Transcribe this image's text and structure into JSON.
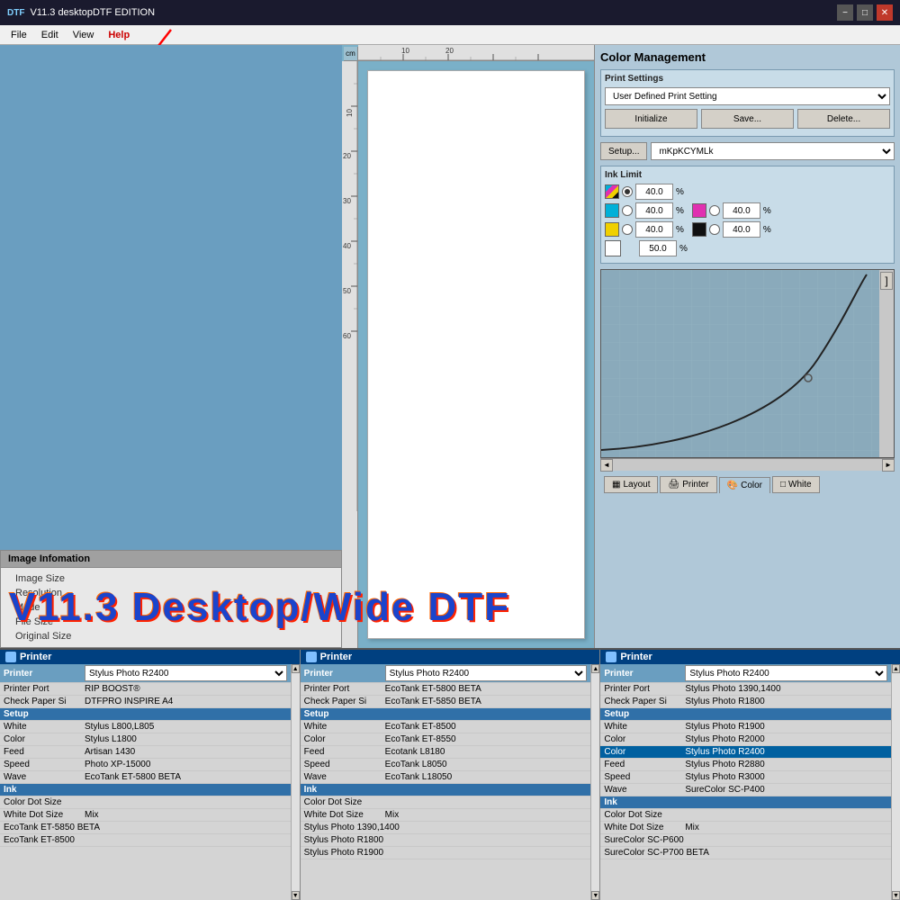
{
  "title_bar": {
    "app_name": "V11.3 desktopDTF EDITION",
    "icon_text": "DTF",
    "min_label": "−",
    "max_label": "□",
    "close_label": "✕"
  },
  "menu": {
    "file": "File",
    "edit": "Edit",
    "view": "View",
    "help": "Help"
  },
  "image_info": {
    "title": "Image Infomation",
    "fields": [
      {
        "label": "Image Size",
        "value": ""
      },
      {
        "label": "Resolution",
        "value": ""
      },
      {
        "label": "Mode",
        "value": ""
      },
      {
        "label": "File Size",
        "value": ""
      },
      {
        "label": "Original Size",
        "value": ""
      }
    ]
  },
  "canvas": {
    "ruler_unit": "cm",
    "ruler_marks_h": [
      "10",
      "20"
    ],
    "ruler_marks_v": [
      "10",
      "20",
      "30",
      "40",
      "50",
      "60"
    ]
  },
  "big_text": "V11.3 Desktop/Wide DTF",
  "color_management": {
    "title": "Color Management",
    "print_settings_label": "Print Settings",
    "print_setting_value": "User Defined Print Setting",
    "initialize_label": "Initialize",
    "save_label": "Save...",
    "delete_label": "Delete...",
    "setup_label": "Setup...",
    "ink_channel_value": "mKpKCYMLk",
    "ink_limit_label": "Ink Limit",
    "cmyk_value": "40.0",
    "cmyk_unit": "%",
    "cyan_value": "40.0",
    "cyan_unit": "%",
    "magenta_value": "40.0",
    "magenta_unit": "%",
    "yellow_value": "40.0",
    "yellow_unit": "%",
    "black_value": "40.0",
    "black_unit": "%",
    "white_value": "50.0",
    "white_unit": "%"
  },
  "tabs": [
    {
      "id": "layout",
      "label": "Layout",
      "icon": "layout-icon"
    },
    {
      "id": "printer",
      "label": "Printer",
      "icon": "printer-icon"
    },
    {
      "id": "color",
      "label": "Color",
      "icon": "color-icon"
    },
    {
      "id": "white",
      "label": "White",
      "icon": "white-icon"
    }
  ],
  "bottom_panels": [
    {
      "id": "panel-left",
      "header": "Printer",
      "printer_label": "Printer",
      "printer_value": "Stylus Photo R2400",
      "rows": [
        {
          "type": "header",
          "label": "Printer",
          "value": "Stylus Photo R2400",
          "has_dropdown": true
        },
        {
          "type": "normal",
          "label": "Printer Port",
          "value": "RIP BOOST®"
        },
        {
          "type": "normal",
          "label": "Check Paper Si",
          "value": "DTFPRO INSPIRE A4"
        },
        {
          "type": "section",
          "label": "Setup",
          "value": ""
        },
        {
          "type": "normal",
          "label": "White",
          "value": "Stylus L800,L805"
        },
        {
          "type": "normal",
          "label": "Color",
          "value": "Stylus L1800"
        },
        {
          "type": "normal",
          "label": "Feed",
          "value": "Artisan 1430"
        },
        {
          "type": "normal",
          "label": "Speed",
          "value": "Photo XP-15000"
        },
        {
          "type": "normal",
          "label": "Wave",
          "value": "EcoTank ET-5800 BETA"
        },
        {
          "type": "section",
          "label": "Ink",
          "value": ""
        },
        {
          "type": "normal",
          "label": "Color Dot Size",
          "value": ""
        },
        {
          "type": "normal",
          "label": "White Dot Size",
          "value": "Mix"
        }
      ],
      "extra_items": [
        "EcoTank ET-5850 BETA",
        "EcoTank ET-8500"
      ]
    },
    {
      "id": "panel-middle",
      "header": "Printer",
      "rows": [
        {
          "type": "header",
          "label": "Printer",
          "value": "Stylus Photo R2400",
          "has_dropdown": true
        },
        {
          "type": "normal",
          "label": "Printer Port",
          "value": "EcoTank ET-5800 BETA"
        },
        {
          "type": "normal",
          "label": "Check Paper Si",
          "value": "EcoTank ET-5850 BETA"
        },
        {
          "type": "section",
          "label": "Setup",
          "value": ""
        },
        {
          "type": "normal",
          "label": "White",
          "value": "EcoTank ET-8500"
        },
        {
          "type": "normal",
          "label": "Color",
          "value": "EcoTank ET-8550"
        },
        {
          "type": "normal",
          "label": "Feed",
          "value": "Ecotank L8180"
        },
        {
          "type": "normal",
          "label": "Speed",
          "value": "EcoTank L8050"
        },
        {
          "type": "normal",
          "label": "Wave",
          "value": "EcoTank L18050"
        },
        {
          "type": "section",
          "label": "Ink",
          "value": ""
        },
        {
          "type": "normal",
          "label": "Color Dot Size",
          "value": ""
        },
        {
          "type": "normal",
          "label": "White Dot Size",
          "value": "Mix"
        }
      ],
      "extra_items": [
        "Stylus Photo 1390,1400",
        "Stylus Photo R1800",
        "Stylus Photo R1900"
      ]
    },
    {
      "id": "panel-right",
      "header": "Printer",
      "rows": [
        {
          "type": "header",
          "label": "Printer",
          "value": "Stylus Photo R2400",
          "has_dropdown": true
        },
        {
          "type": "normal",
          "label": "Printer Port",
          "value": "Stylus Photo 1390,1400"
        },
        {
          "type": "normal",
          "label": "Check Paper Si",
          "value": "Stylus Photo R1800"
        },
        {
          "type": "section",
          "label": "Setup",
          "value": ""
        },
        {
          "type": "normal",
          "label": "White",
          "value": "Stylus Photo R1900"
        },
        {
          "type": "normal",
          "label": "Color",
          "value": "Stylus Photo R2000"
        },
        {
          "type": "selected",
          "label": "Color",
          "value": "Stylus Photo R2400"
        },
        {
          "type": "normal",
          "label": "Feed",
          "value": "Stylus Photo R2880"
        },
        {
          "type": "normal",
          "label": "Speed",
          "value": "Stylus Photo R3000"
        },
        {
          "type": "normal",
          "label": "Wave",
          "value": "SureColor SC-P400"
        },
        {
          "type": "section",
          "label": "Ink",
          "value": ""
        },
        {
          "type": "normal",
          "label": "Color Dot Size",
          "value": ""
        },
        {
          "type": "normal",
          "label": "White Dot Size",
          "value": "Mix"
        }
      ],
      "extra_items": [
        "SureColor SC-P600",
        "SureColor SC-P700 BETA"
      ]
    }
  ]
}
